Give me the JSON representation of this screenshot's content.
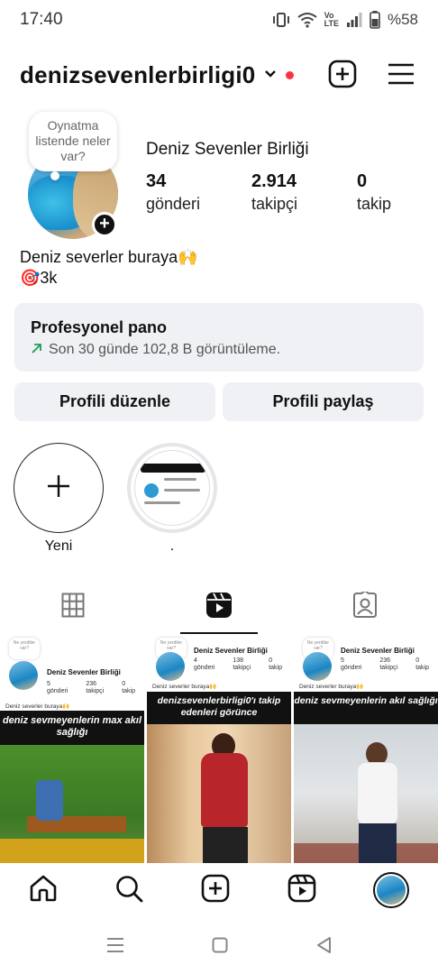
{
  "status_bar": {
    "time": "17:40",
    "battery": "%58"
  },
  "header": {
    "username": "denizsevenlerbirligi0"
  },
  "note": {
    "text": "Oynatma listende neler var?"
  },
  "profile": {
    "full_name": "Deniz Sevenler Birliği",
    "stats": [
      {
        "value": "34",
        "label": "gönderi"
      },
      {
        "value": "2.914",
        "label": "takipçi"
      },
      {
        "value": "0",
        "label": "takip"
      }
    ],
    "bio_line1": "Deniz severler buraya🙌",
    "bio_line2": "🎯3k"
  },
  "pro_dashboard": {
    "title": "Profesyonel pano",
    "subtitle": "Son 30 günde 102,8 B görüntüleme."
  },
  "buttons": {
    "edit": "Profili düzenle",
    "share": "Profili paylaş"
  },
  "highlights": [
    {
      "label": "Yeni"
    },
    {
      "label": "."
    }
  ],
  "grid": [
    {
      "mini_name": "Deniz Sevenler Birliği",
      "mini_stats": [
        "5",
        "236",
        "0"
      ],
      "mini_labels": [
        "gönderi",
        "takipçi",
        "takip"
      ],
      "mini_bio": "Deniz severler buraya🙌",
      "mini_note": "Ne yerdiler var?",
      "caption": "deniz sevmeyenlerin max akıl sağlığı"
    },
    {
      "mini_name": "Deniz Sevenler Birliği",
      "mini_stats": [
        "4",
        "138",
        "0"
      ],
      "mini_labels": [
        "gönderi",
        "takipçi",
        "takip"
      ],
      "mini_bio": "Deniz severler buraya🙌",
      "mini_note": "Ne yerdiler var?",
      "caption": "denizsevenlerbirligi0'ı takip edenleri görünce"
    },
    {
      "mini_name": "Deniz Sevenler Birliği",
      "mini_stats": [
        "5",
        "236",
        "0"
      ],
      "mini_labels": [
        "gönderi",
        "takipçi",
        "takip"
      ],
      "mini_bio": "Deniz severler buraya🙌",
      "mini_note": "Ne yerdiler var?",
      "caption": "deniz sevmeyenlerin akıl sağlığı"
    }
  ],
  "icons": {
    "header": [
      "add-post-icon",
      "menu-icon"
    ],
    "tabs": [
      "grid-icon",
      "reels-icon",
      "tagged-icon"
    ],
    "bottom_nav": [
      "home-icon",
      "search-icon",
      "create-icon",
      "reels-icon",
      "profile-avatar"
    ],
    "system_nav": [
      "recents-icon",
      "home-button-icon",
      "back-icon"
    ]
  },
  "colors": {
    "notification_dot": "#ff3040",
    "growth_arrow": "#1a9e55",
    "card_bg": "#eff1f4"
  }
}
